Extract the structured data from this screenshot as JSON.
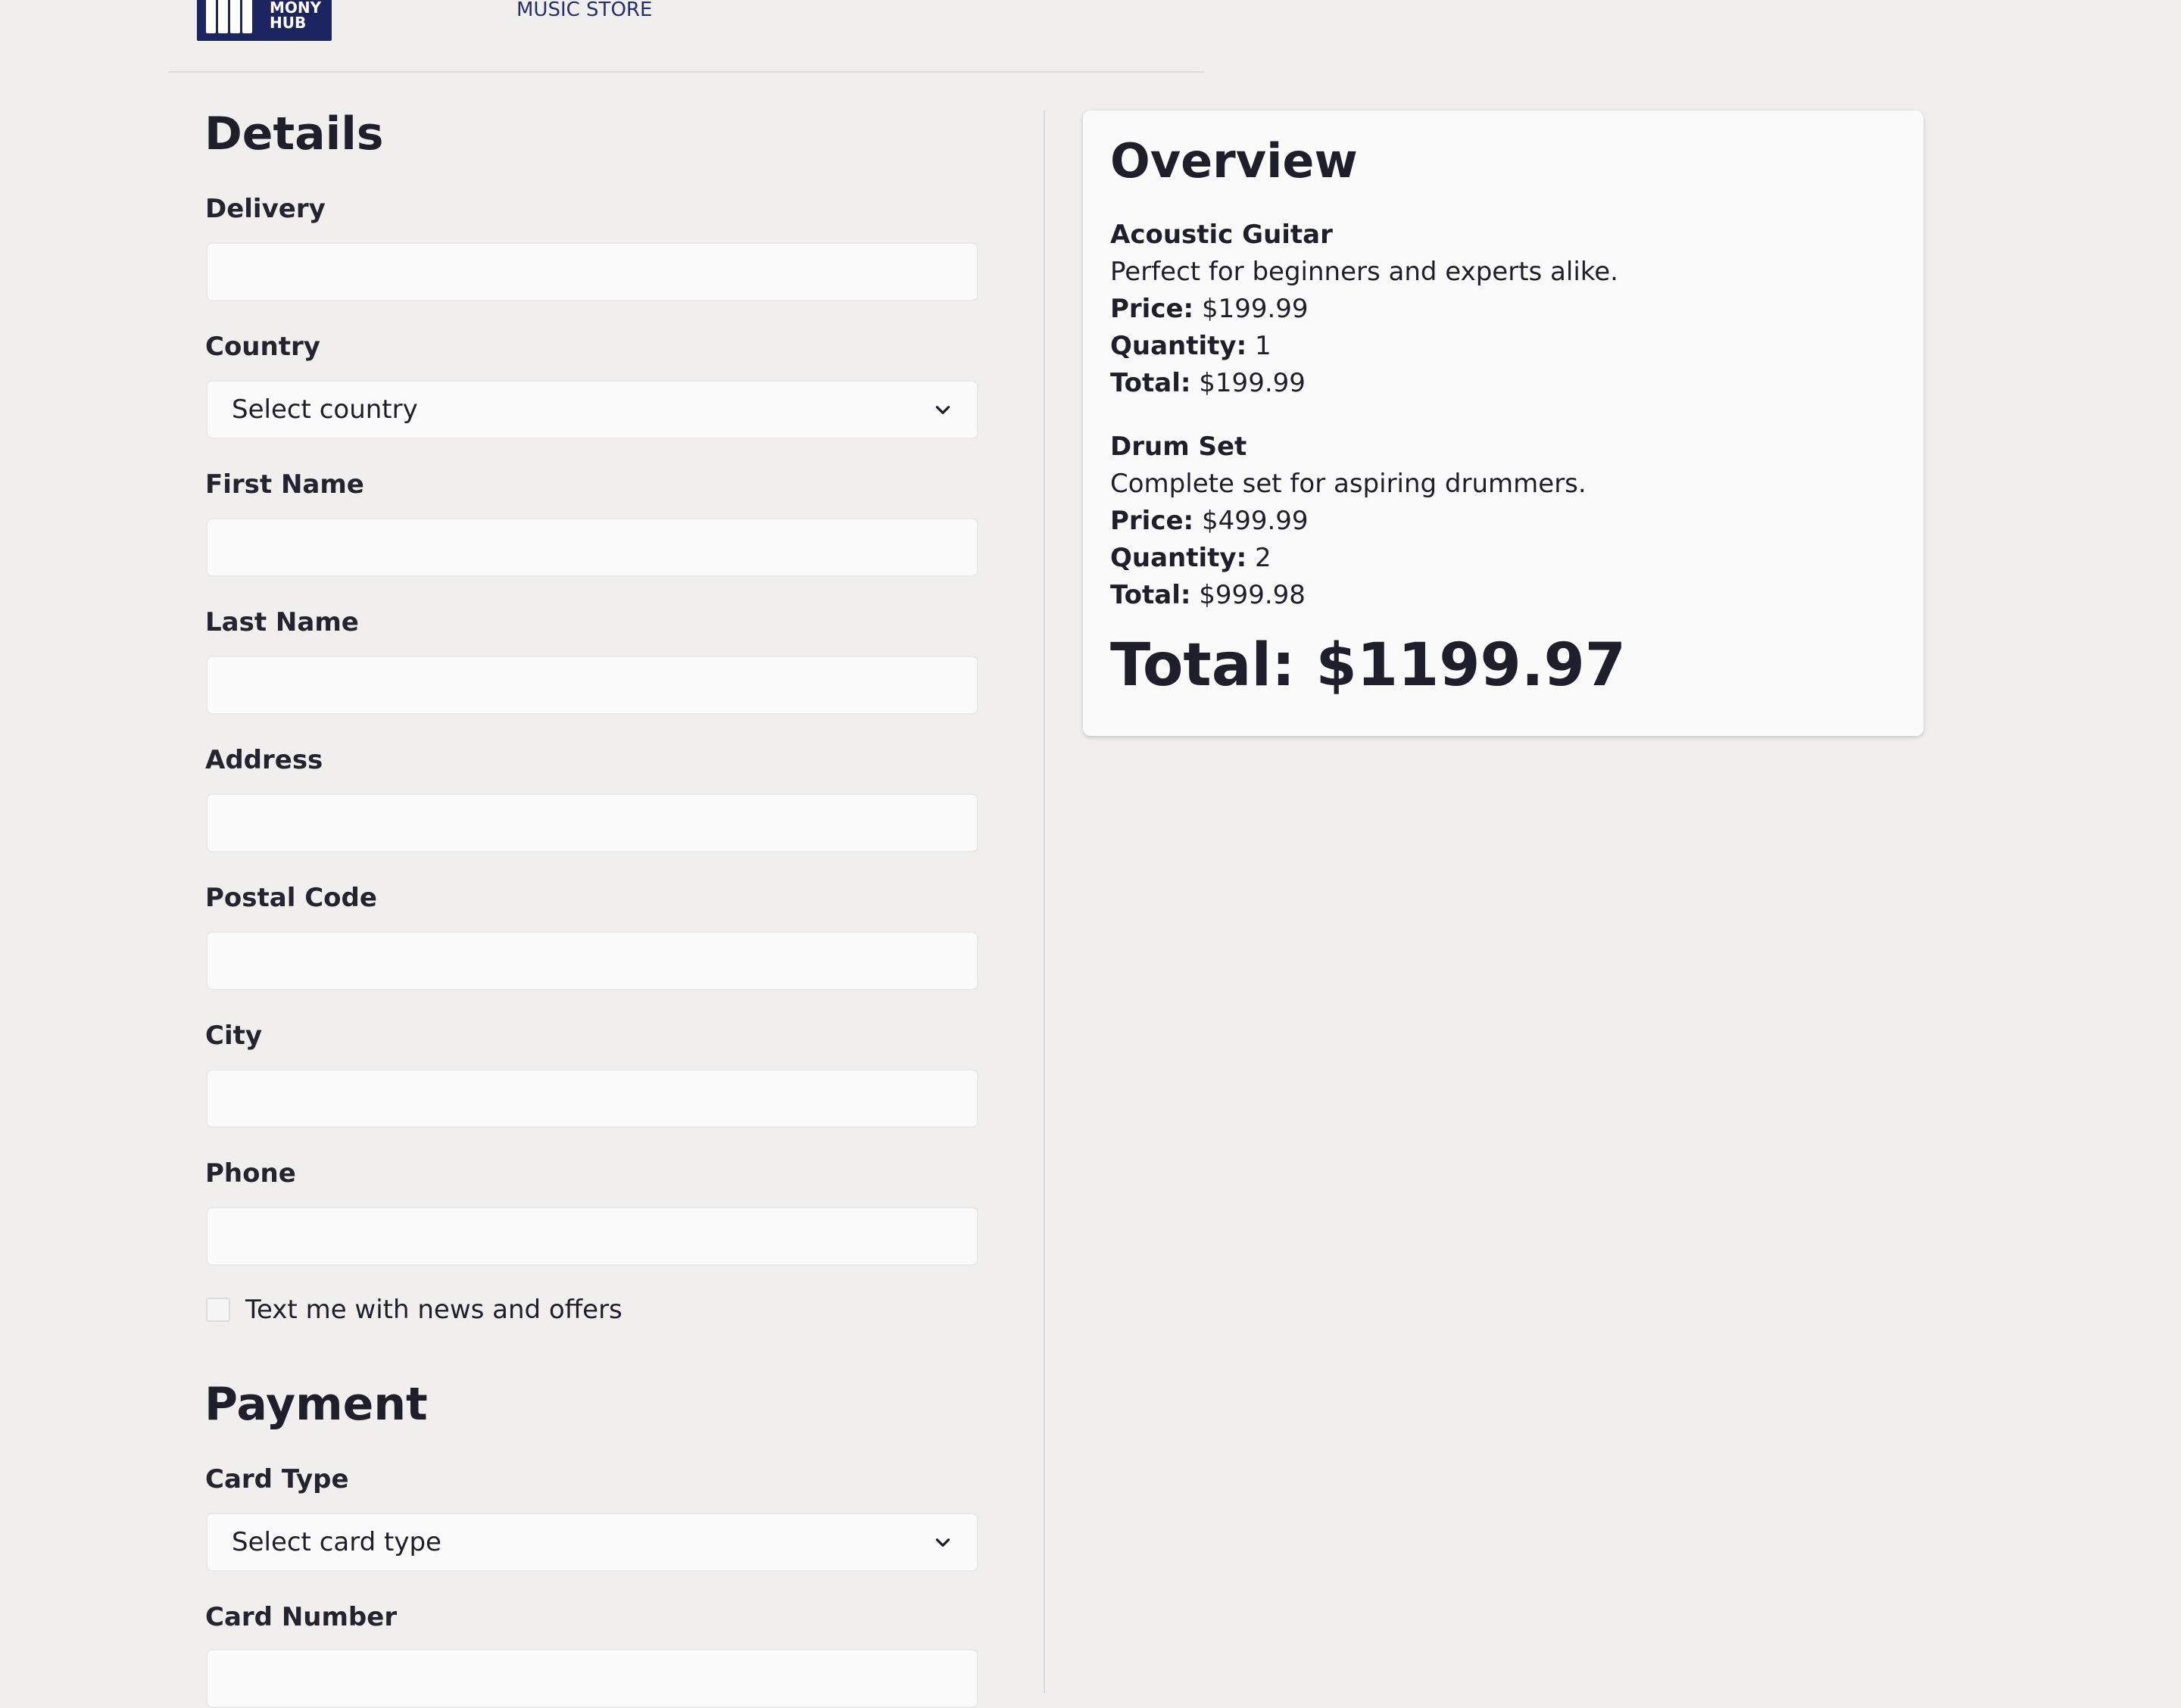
{
  "header": {
    "logo_text_line1": "MONY",
    "logo_text_line2": "HUB",
    "store_name": "MUSIC STORE"
  },
  "details": {
    "title": "Details",
    "fields": {
      "delivery": {
        "label": "Delivery",
        "value": ""
      },
      "country": {
        "label": "Country",
        "selected": "Select country"
      },
      "first_name": {
        "label": "First Name",
        "value": ""
      },
      "last_name": {
        "label": "Last Name",
        "value": ""
      },
      "address": {
        "label": "Address",
        "value": ""
      },
      "postal_code": {
        "label": "Postal Code",
        "value": ""
      },
      "city": {
        "label": "City",
        "value": ""
      },
      "phone": {
        "label": "Phone",
        "value": ""
      }
    },
    "newsletter_label": "Text me with news and offers",
    "newsletter_checked": false
  },
  "payment": {
    "title": "Payment",
    "card_type": {
      "label": "Card Type",
      "selected": "Select card type"
    },
    "card_number": {
      "label": "Card Number",
      "value": ""
    }
  },
  "overview": {
    "title": "Overview",
    "price_label": "Price:",
    "quantity_label": "Quantity:",
    "total_label": "Total:",
    "items": [
      {
        "name": "Acoustic Guitar",
        "description": "Perfect for beginners and experts alike.",
        "price": "$199.99",
        "quantity": "1",
        "total": "$199.99"
      },
      {
        "name": "Drum Set",
        "description": "Complete set for aspiring drummers.",
        "price": "$499.99",
        "quantity": "2",
        "total": "$999.98"
      }
    ],
    "grand_total_label": "Total:",
    "grand_total": "$1199.97"
  },
  "icons": {
    "logo": "piano-keys-icon",
    "select_arrow": "chevron-down-icon"
  },
  "colors": {
    "background": "#f0efed",
    "brand": "#1c2560",
    "text": "#1e1f2b",
    "input_bg": "#fafafa"
  }
}
